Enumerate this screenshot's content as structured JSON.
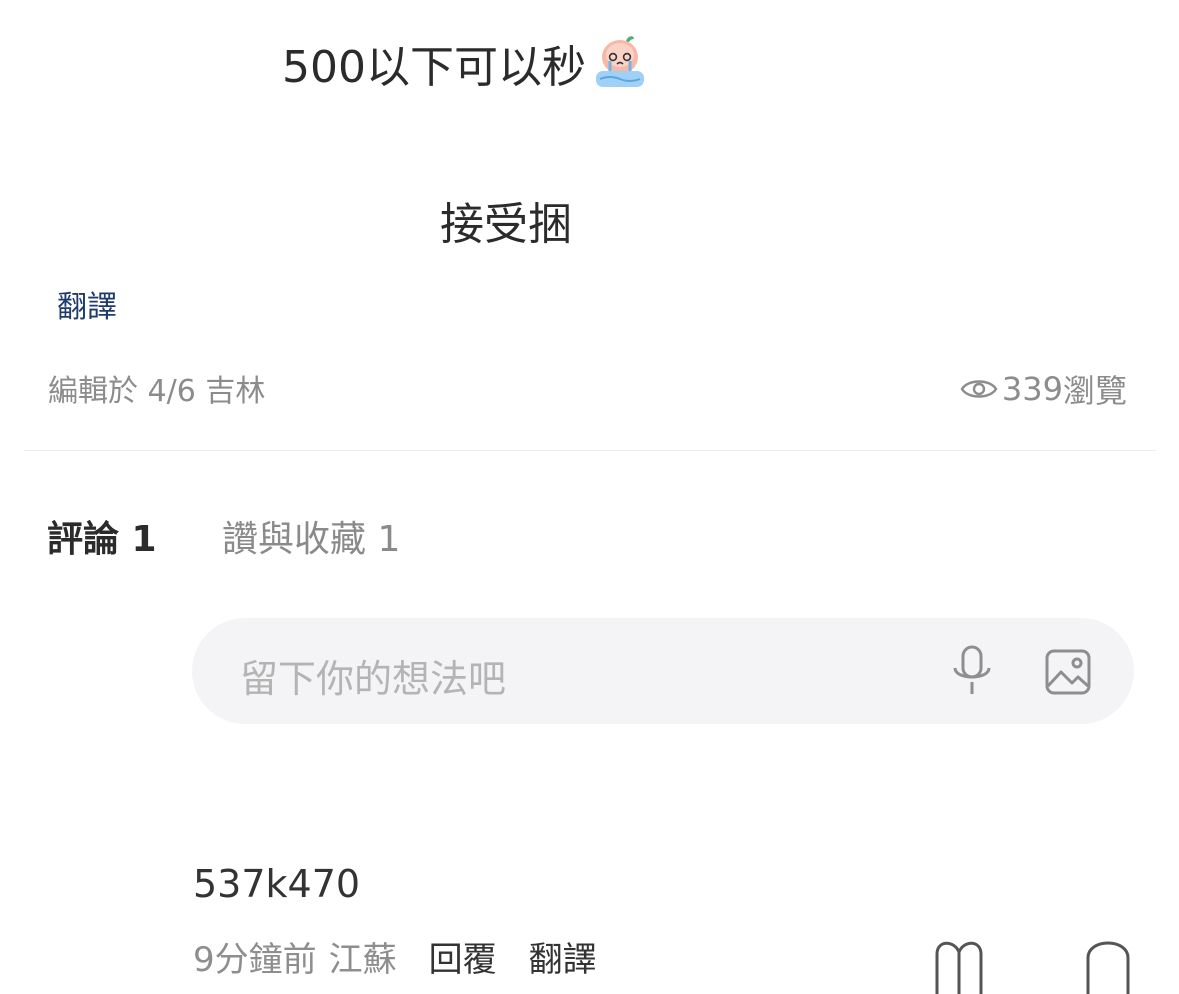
{
  "post": {
    "line1": "500以下可以秒",
    "line1_emoji": "crying-peach-emoji",
    "line2": "接受捆",
    "translate_label": "翻譯"
  },
  "meta": {
    "edited_label": "編輯於 4/6 吉林",
    "views_count": "339",
    "views_label": "瀏覽"
  },
  "tabs": {
    "comments": "評論 1",
    "likes_favorites": "讚與收藏 1"
  },
  "comment_input": {
    "placeholder": "留下你的想法吧",
    "icons": [
      "microphone-icon",
      "image-icon"
    ]
  },
  "comments": [
    {
      "username": "537k470",
      "time": "9分鐘前",
      "location": "江蘇",
      "reply_label": "回覆",
      "translate_label": "翻譯",
      "icons": [
        "heart-icon",
        "star-icon"
      ]
    }
  ],
  "colors": {
    "link": "#1f3b6e",
    "muted": "#8c8c8c",
    "input_bg": "#f4f4f6"
  }
}
